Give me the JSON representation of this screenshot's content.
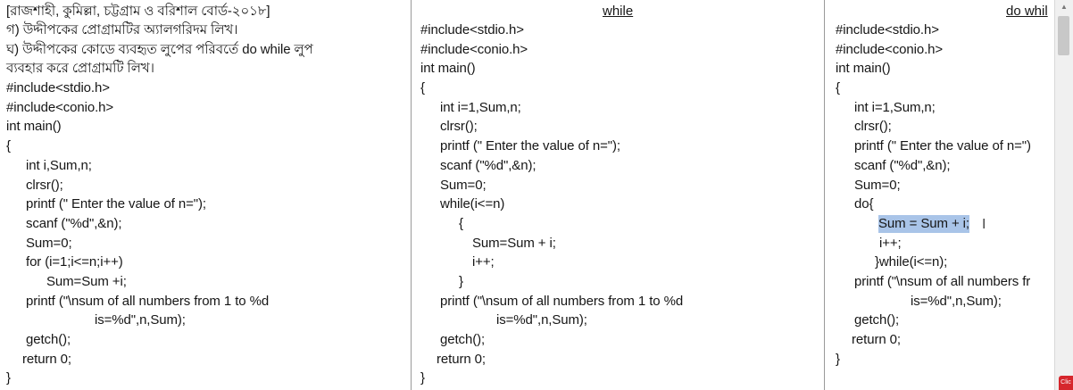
{
  "column1": {
    "lines": [
      "[রাজশাহী, কুমিল্লা, চট্টগ্রাম ও বরিশাল বোর্ড-২০১৮]",
      "গ) উদ্দীপকের প্রোগ্রামটির অ্যালগরিদম লিখ।",
      "ঘ) উদ্দীপকের কোডে ব্যবহৃত লুপের পরিবর্তে do while লুপ",
      "ব্যবহার করে প্রোগ্রামটি লিখ।",
      "#include<stdio.h>",
      "#include<conio.h>",
      "int main()",
      "{",
      "int i,Sum,n;",
      "clrsr();",
      "printf (\" Enter the value of n=\");",
      "scanf (\"%d\",&n);",
      "Sum=0;",
      "for (i=1;i<=n;i++)",
      "Sum=Sum +i;",
      "printf (\"\\nsum of all numbers from 1 to %d",
      "is=%d\",n,Sum);",
      "getch();",
      "return 0;",
      "}"
    ]
  },
  "column2": {
    "title": "while",
    "lines": [
      "#include<stdio.h>",
      "#include<conio.h>",
      "int main()",
      "{",
      "int i=1,Sum,n;",
      "clrsr();",
      "printf (\" Enter the value of n=\");",
      "scanf (\"%d\",&n);",
      "Sum=0;",
      "while(i<=n)",
      "{",
      "Sum=Sum + i;",
      "i++;",
      "}",
      "printf (\"\\nsum of all numbers from 1 to %d",
      "is=%d\",n,Sum);",
      "getch();",
      "return 0;",
      "}"
    ]
  },
  "column3": {
    "title": "do whil",
    "lines": [
      "#include<stdio.h>",
      "#include<conio.h>",
      "int main()",
      "{",
      "int i=1,Sum,n;",
      "clrsr();",
      "printf (\" Enter the value of n=\")",
      "scanf (\"%d\",&n);",
      "Sum=0;",
      "do{",
      "Sum = Sum + i;",
      "i++;",
      "}while(i<=n);",
      "printf (\"\\nsum of all numbers fr",
      "is=%d\",n,Sum);",
      "getch();",
      "return 0;",
      "}"
    ],
    "highlight_color": "#a9c4e8"
  },
  "badge": {
    "label": "Clic"
  },
  "icons": {
    "cursor": "i-beam-cursor-icon",
    "scroll_up": "scroll-up-arrow-icon"
  }
}
